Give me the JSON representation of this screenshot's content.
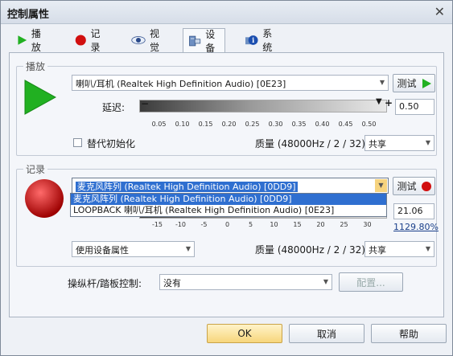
{
  "window": {
    "title": "控制属性"
  },
  "tabs": [
    {
      "label": "播放",
      "icon": "play-icon"
    },
    {
      "label": "记录",
      "icon": "record-icon"
    },
    {
      "label": "视觉",
      "icon": "eye-icon"
    },
    {
      "label": "设备",
      "icon": "device-icon"
    },
    {
      "label": "系统",
      "icon": "info-icon"
    }
  ],
  "active_tab": "设备",
  "playback": {
    "group_label": "播放",
    "device": "喇叭/耳机 (Realtek High Definition Audio) [0E23]",
    "test_label": "测试",
    "delay_label": "延迟:",
    "delay_value": "0.50",
    "delay_ticks": [
      "0.05",
      "0.10",
      "0.15",
      "0.20",
      "0.25",
      "0.30",
      "0.35",
      "0.40",
      "0.45",
      "0.50"
    ],
    "alt_init_label": "替代初始化",
    "alt_init_checked": false,
    "quality_label": "质量 (48000Hz / 2 / 32):",
    "quality_value": "共享"
  },
  "record": {
    "group_label": "记录",
    "device": "麦克风阵列 (Realtek High Definition Audio) [0DD9]",
    "test_label": "测试",
    "dropdown_options": [
      "麦克风阵列 (Realtek High Definition Audio) [0DD9]",
      "LOOPBACK 喇叭/耳机 (Realtek High Definition Audio) [0E23]"
    ],
    "selected_option_index": 0,
    "gain_ticks": [
      "-15",
      "-10",
      "-5",
      "0",
      "5",
      "10",
      "15",
      "20",
      "25",
      "30"
    ],
    "gain_value": "21.06",
    "gain_percent": "1129.80%",
    "property_mode": "使用设备属性",
    "quality_label": "质量 (48000Hz / 2 / 32):",
    "quality_value": "共享"
  },
  "joystick": {
    "label": "操纵杆/踏板控制:",
    "value": "没有",
    "config_label": "配置..."
  },
  "footer": {
    "ok_label": "OK",
    "cancel_label": "取消",
    "help_label": "帮助"
  },
  "colors": {
    "play_green": "#21b021",
    "record_red": "#d10f0f",
    "accent_blue": "#2f6fd0"
  }
}
